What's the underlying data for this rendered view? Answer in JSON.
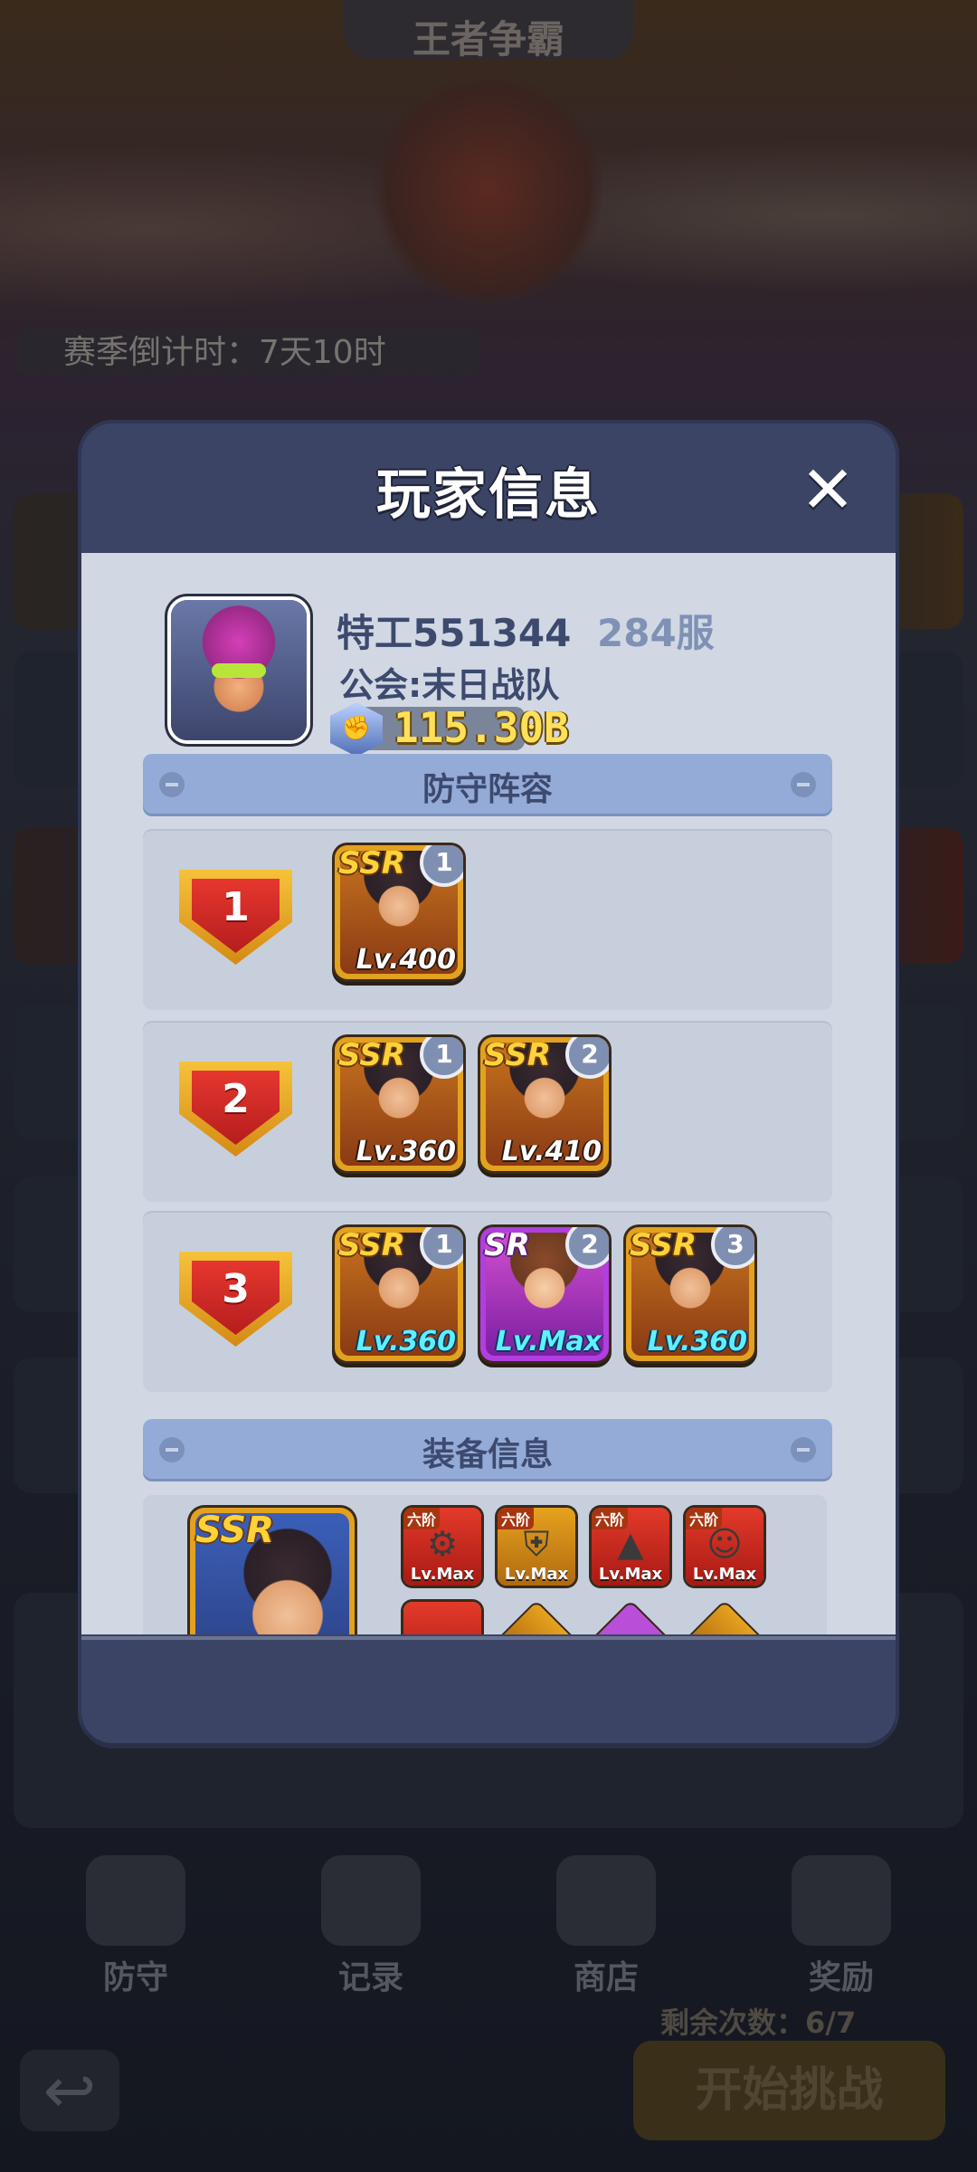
{
  "background": {
    "title": "王者争霸",
    "countdown": "赛季倒计时：7天10时",
    "nav": [
      {
        "label": "防守",
        "icon": "shield-icon"
      },
      {
        "label": "记录",
        "icon": "scroll-icon"
      },
      {
        "label": "商店",
        "icon": "shop-icon"
      },
      {
        "label": "奖励",
        "icon": "gift-icon"
      }
    ],
    "remaining": "剩余次数：6/7",
    "start_button": "开始挑战",
    "back_icon": "back-arrow-icon"
  },
  "modal": {
    "title": "玩家信息",
    "close_icon": "close-icon",
    "player": {
      "name": "特工551344",
      "server": "284服",
      "guild": "公会:末日战队",
      "power": "115.30B",
      "power_icon": "fist-icon"
    },
    "defense_header": "防守阵容",
    "lineups": [
      {
        "rank": "1",
        "heroes": [
          {
            "rarity": "SSR",
            "slot": "1",
            "level": "Lv.400",
            "level_color": "white"
          }
        ]
      },
      {
        "rank": "2",
        "heroes": [
          {
            "rarity": "SSR",
            "slot": "1",
            "level": "Lv.360",
            "level_color": "white"
          },
          {
            "rarity": "SSR",
            "slot": "2",
            "level": "Lv.410",
            "level_color": "white"
          }
        ]
      },
      {
        "rank": "3",
        "heroes": [
          {
            "rarity": "SSR",
            "slot": "1",
            "level": "Lv.360",
            "level_color": "cyan"
          },
          {
            "rarity": "SR",
            "slot": "2",
            "level": "Lv.Max",
            "level_color": "cyan"
          },
          {
            "rarity": "SSR",
            "slot": "3",
            "level": "Lv.360",
            "level_color": "cyan"
          }
        ]
      }
    ],
    "equipment_header": "装备信息",
    "equipment": {
      "hero_rarity": "SSR",
      "items": [
        {
          "tier": "六阶",
          "level": "Lv.Max",
          "color": "red",
          "icon": "gun-icon"
        },
        {
          "tier": "六阶",
          "level": "Lv.Max",
          "color": "gold",
          "icon": "armor-icon"
        },
        {
          "tier": "六阶",
          "level": "Lv.Max",
          "color": "red",
          "icon": "boot-icon"
        },
        {
          "tier": "六阶",
          "level": "Lv.Max",
          "color": "red",
          "icon": "mask-icon"
        }
      ]
    }
  }
}
